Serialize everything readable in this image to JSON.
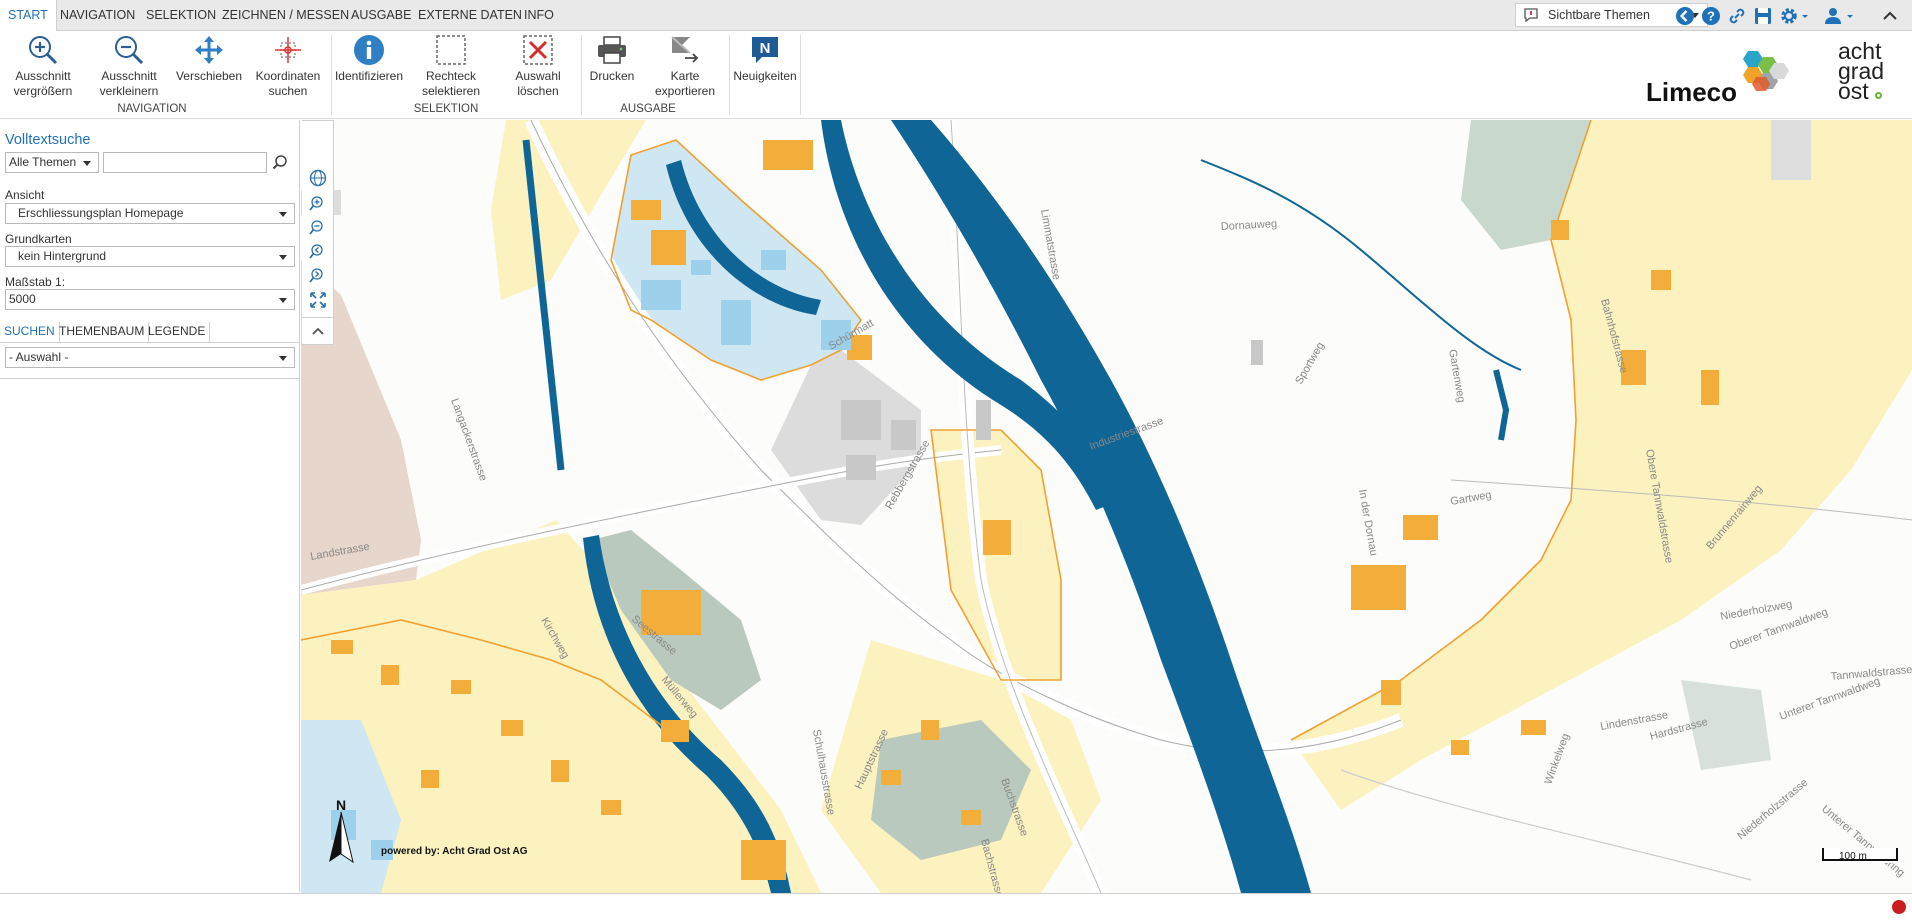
{
  "menu": {
    "tabs": [
      "START",
      "NAVIGATION",
      "SELEKTION",
      "ZEICHNEN / MESSEN",
      "AUSGABE",
      "EXTERNE DATEN",
      "INFO"
    ],
    "themes_dropdown": "Sichtbare Themen"
  },
  "ribbon": {
    "buttons": [
      {
        "label": "Ausschnitt\nvergrößern",
        "icon": "zoom-in-icon"
      },
      {
        "label": "Ausschnitt\nverkleinern",
        "icon": "zoom-out-icon"
      },
      {
        "label": "Verschieben",
        "icon": "pan-icon"
      },
      {
        "label": "Koordinaten\nsuchen",
        "icon": "crosshair-icon"
      },
      {
        "label": "Identifizieren",
        "icon": "info-icon"
      },
      {
        "label": "Rechteck\nselektieren",
        "icon": "rectangle-select-icon"
      },
      {
        "label": "Auswahl\nlöschen",
        "icon": "clear-selection-icon"
      },
      {
        "label": "Drucken",
        "icon": "print-icon"
      },
      {
        "label": "Karte\nexportieren",
        "icon": "export-map-icon"
      },
      {
        "label": "Neuigkeiten",
        "icon": "news-icon"
      }
    ],
    "groups": [
      "NAVIGATION",
      "SELEKTION",
      "AUSGABE"
    ],
    "logo_limeco": "Limeco",
    "logo_agos": [
      "acht",
      "grad",
      "ost"
    ]
  },
  "sidebar": {
    "title": "Volltextsuche",
    "search_scope": "Alle Themen",
    "search_value": "",
    "ansicht_label": "Ansicht",
    "ansicht_value": "Erschliessungsplan Homepage",
    "grundkarten_label": "Grundkarten",
    "grundkarten_value": "kein Hintergrund",
    "massstab_label": "Maßstab 1:",
    "massstab_value": "5000",
    "tabs": [
      "SUCHEN",
      "THEMENBAUM",
      "LEGENDE"
    ],
    "auswahl_value": "- Auswahl -"
  },
  "map": {
    "north_label": "N",
    "powered_by": "powered by: Acht Grad Ost AG",
    "scale_label": "100 m",
    "streets": [
      "Limmatstrasse",
      "Dornauweg",
      "Sportweg",
      "Gartenweg",
      "Gartweg",
      "Brunnenrainweg",
      "Niederholzweg",
      "Oberer Tannwaldweg",
      "Tannwaldstrasse",
      "Unterer Tannwaldweg",
      "Unterer Tannwaldring",
      "Schulhausstrasse",
      "Schürmatt",
      "Hauptstrasse",
      "Landstrasse",
      "Bachstrasse",
      "Langackerstrasse",
      "Niederholzstrasse",
      "Winkelweg",
      "Bahnhofstrasse",
      "Hardstrasse",
      "Lindenstrasse",
      "In der Dornau",
      "Rebbergstrasse",
      "Industriestrasse",
      "Buchstrasse",
      "Kirchweg",
      "Seestrasse",
      "Müllerweg",
      "Obere Tannwaldstrasse"
    ]
  },
  "colors": {
    "river": "#0f6595",
    "building_orange": "#f3ad3a",
    "zone_yellow": "#fbf2bf",
    "zone_blue": "#cfe6f3",
    "zone_green": "#b9c9bd",
    "zone_gray": "#d6d6d6",
    "zone_brown": "#e3d0c4",
    "accent_blue": "#1f72b8"
  }
}
